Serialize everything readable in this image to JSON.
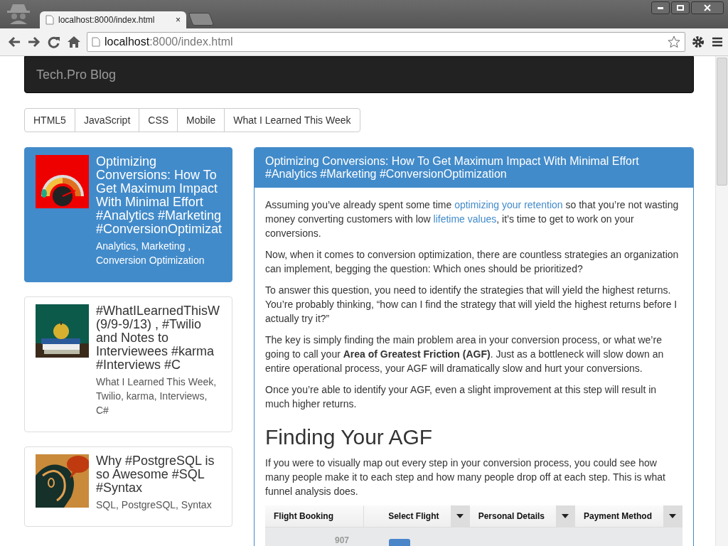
{
  "browser": {
    "tab_title": "localhost:8000/index.html",
    "tab_close": "×",
    "url_host": "localhost",
    "url_rest": ":8000/index.html"
  },
  "navbar": {
    "brand": "Tech.Pro Blog"
  },
  "categories": [
    {
      "label": "HTML5"
    },
    {
      "label": "JavaScript"
    },
    {
      "label": "CSS"
    },
    {
      "label": "Mobile"
    },
    {
      "label": "What I Learned This Week"
    }
  ],
  "posts": [
    {
      "selected": true,
      "title_lines": [
        "Optimizing",
        "Conversions: How To",
        "Get Maximum Impact",
        "With Minimal Effort",
        "#Analytics #Marketing",
        "#ConversionOptimizat"
      ],
      "tags_lines": [
        "Analytics, Marketing ,",
        "Conversion Optimization"
      ]
    },
    {
      "selected": false,
      "title_lines": [
        "#WhatILearnedThisW",
        "(9/9-9/13) , #Twilio",
        "and Notes to",
        "Interviewees #karma",
        "#Interviews #C"
      ],
      "tags_lines": [
        "What I Learned This Week,",
        "Twilio, karma, Interviews,",
        "C#"
      ]
    },
    {
      "selected": false,
      "title_lines": [
        "Why #PostgreSQL is",
        "so Awesome #SQL",
        "#Syntax"
      ],
      "tags_lines": [
        "SQL, PostgreSQL, Syntax"
      ]
    }
  ],
  "article": {
    "title": "Optimizing Conversions: How To Get Maximum Impact With Minimal Effort #Analytics #Marketing #ConversionOptimization",
    "blocks": [
      {
        "kind": "paragraph",
        "parts": [
          {
            "kind": "text",
            "text": "Assuming you’ve already spent some time "
          },
          {
            "kind": "link",
            "text": "optimizing your retention"
          },
          {
            "kind": "text",
            "text": " so that you’re not wasting money converting customers with low "
          },
          {
            "kind": "link",
            "text": "lifetime values"
          },
          {
            "kind": "text",
            "text": ", it’s time to get to work on your conversions."
          }
        ]
      },
      {
        "kind": "paragraph",
        "parts": [
          {
            "kind": "text",
            "text": "Now, when it comes to conversion optimization, there are countless strategies an organization can implement, begging the question: Which ones should be prioritized?"
          }
        ]
      },
      {
        "kind": "paragraph",
        "parts": [
          {
            "kind": "text",
            "text": "To answer this question, you need to identify the strategies that will yield the highest returns. You’re probably thinking, “how can I find the strategy that will yield the highest returns before I actually try it?”"
          }
        ]
      },
      {
        "kind": "paragraph",
        "parts": [
          {
            "kind": "text",
            "text": "The key is simply finding the main problem area in your conversion process, or what we’re going to call your "
          },
          {
            "kind": "bold",
            "text": "Area of Greatest Friction (AGF)"
          },
          {
            "kind": "text",
            "text": ". Just as a bottleneck will slow down an entire operational process, your AGF will dramatically slow and hurt your conversions."
          }
        ]
      },
      {
        "kind": "paragraph",
        "parts": [
          {
            "kind": "text",
            "text": "Once you’re able to identify your AGF, even a slight improvement at this step will result in much higher returns."
          }
        ]
      },
      {
        "kind": "heading",
        "text": "Finding Your AGF"
      },
      {
        "kind": "paragraph",
        "parts": [
          {
            "kind": "text",
            "text": "If you were to visually map out every step in your conversion process, you could see how many people make it to each step and how many people drop off at each step. This is what funnel analysis does."
          }
        ]
      },
      {
        "kind": "funnel",
        "columns": [
          {
            "label": "Flight Booking",
            "dropdown": false
          },
          {
            "label": "Select Flight",
            "dropdown": true
          },
          {
            "label": "Personal Details",
            "dropdown": true
          },
          {
            "label": "Payment Method",
            "dropdown": true
          }
        ],
        "tick_label": "907"
      }
    ]
  }
}
